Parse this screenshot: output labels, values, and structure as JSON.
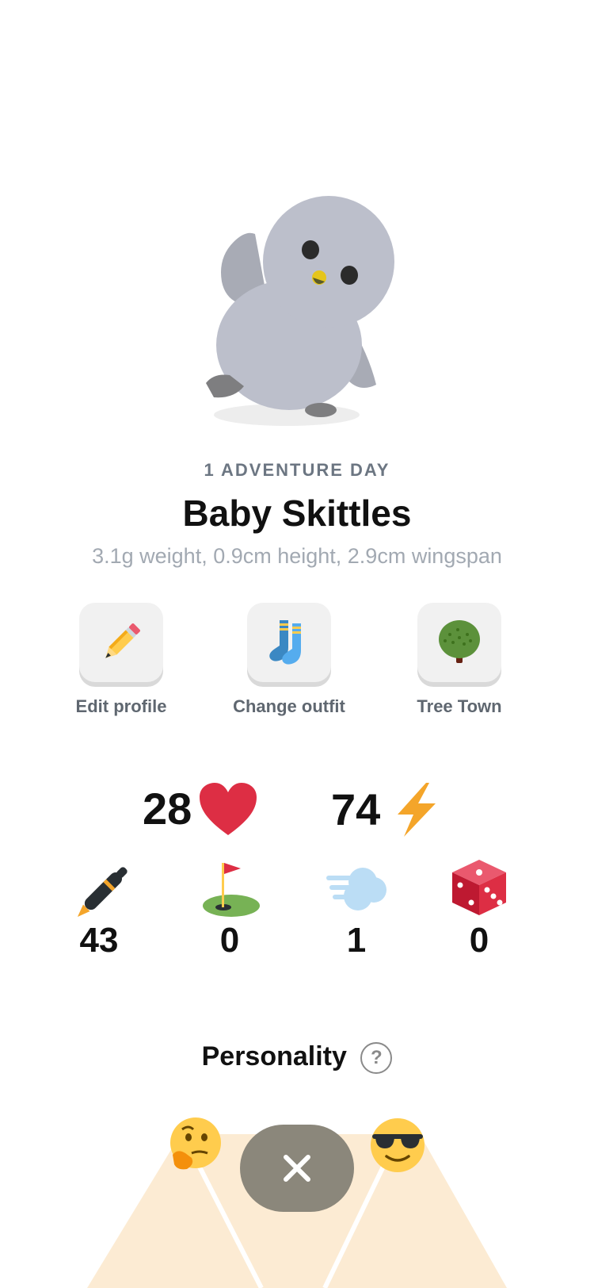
{
  "header": {
    "adventure_day": "1 ADVENTURE DAY",
    "name": "Baby Skittles",
    "measurements": "3.1g weight, 0.9cm height, 2.9cm wingspan"
  },
  "actions": [
    {
      "label": "Edit profile",
      "icon": "pencil-icon"
    },
    {
      "label": "Change outfit",
      "icon": "socks-icon"
    },
    {
      "label": "Tree Town",
      "icon": "tree-icon"
    }
  ],
  "big_stats": [
    {
      "value": "28",
      "icon": "heart-icon"
    },
    {
      "value": "74",
      "icon": "lightning-icon"
    }
  ],
  "small_stats": [
    {
      "value": "43",
      "icon": "pen-icon"
    },
    {
      "value": "0",
      "icon": "golf-flag-icon"
    },
    {
      "value": "1",
      "icon": "wind-icon"
    },
    {
      "value": "0",
      "icon": "dice-icon"
    }
  ],
  "personality": {
    "title": "Personality",
    "help": "?",
    "left_icon": "thinking-face-icon",
    "right_icon": "sunglasses-face-icon",
    "close_icon": "close-icon"
  },
  "colors": {
    "heart": "#dd2e44",
    "lightning": "#f4a52a",
    "bird": "#bcbfcb",
    "close_button": "#8b877b",
    "personality_area": "#fcebd3"
  }
}
